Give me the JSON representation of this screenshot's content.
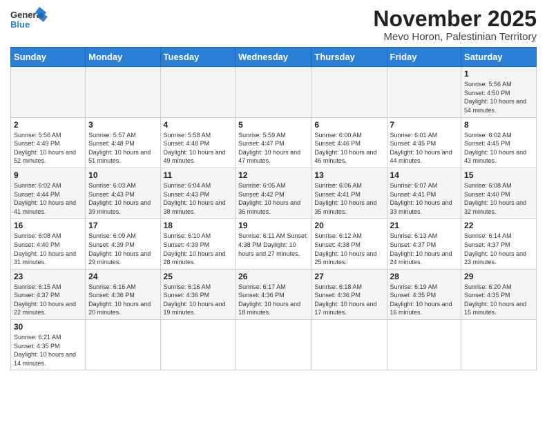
{
  "header": {
    "logo_general": "General",
    "logo_blue": "Blue",
    "month": "November 2025",
    "location": "Mevo Horon, Palestinian Territory"
  },
  "weekdays": [
    "Sunday",
    "Monday",
    "Tuesday",
    "Wednesday",
    "Thursday",
    "Friday",
    "Saturday"
  ],
  "weeks": [
    [
      {
        "day": "",
        "info": ""
      },
      {
        "day": "",
        "info": ""
      },
      {
        "day": "",
        "info": ""
      },
      {
        "day": "",
        "info": ""
      },
      {
        "day": "",
        "info": ""
      },
      {
        "day": "",
        "info": ""
      },
      {
        "day": "1",
        "info": "Sunrise: 5:56 AM\nSunset: 4:50 PM\nDaylight: 10 hours\nand 54 minutes."
      }
    ],
    [
      {
        "day": "2",
        "info": "Sunrise: 5:56 AM\nSunset: 4:49 PM\nDaylight: 10 hours\nand 52 minutes."
      },
      {
        "day": "3",
        "info": "Sunrise: 5:57 AM\nSunset: 4:48 PM\nDaylight: 10 hours\nand 51 minutes."
      },
      {
        "day": "4",
        "info": "Sunrise: 5:58 AM\nSunset: 4:48 PM\nDaylight: 10 hours\nand 49 minutes."
      },
      {
        "day": "5",
        "info": "Sunrise: 5:59 AM\nSunset: 4:47 PM\nDaylight: 10 hours\nand 47 minutes."
      },
      {
        "day": "6",
        "info": "Sunrise: 6:00 AM\nSunset: 4:46 PM\nDaylight: 10 hours\nand 46 minutes."
      },
      {
        "day": "7",
        "info": "Sunrise: 6:01 AM\nSunset: 4:45 PM\nDaylight: 10 hours\nand 44 minutes."
      },
      {
        "day": "8",
        "info": "Sunrise: 6:02 AM\nSunset: 4:45 PM\nDaylight: 10 hours\nand 43 minutes."
      }
    ],
    [
      {
        "day": "9",
        "info": "Sunrise: 6:02 AM\nSunset: 4:44 PM\nDaylight: 10 hours\nand 41 minutes."
      },
      {
        "day": "10",
        "info": "Sunrise: 6:03 AM\nSunset: 4:43 PM\nDaylight: 10 hours\nand 39 minutes."
      },
      {
        "day": "11",
        "info": "Sunrise: 6:04 AM\nSunset: 4:43 PM\nDaylight: 10 hours\nand 38 minutes."
      },
      {
        "day": "12",
        "info": "Sunrise: 6:05 AM\nSunset: 4:42 PM\nDaylight: 10 hours\nand 36 minutes."
      },
      {
        "day": "13",
        "info": "Sunrise: 6:06 AM\nSunset: 4:41 PM\nDaylight: 10 hours\nand 35 minutes."
      },
      {
        "day": "14",
        "info": "Sunrise: 6:07 AM\nSunset: 4:41 PM\nDaylight: 10 hours\nand 33 minutes."
      },
      {
        "day": "15",
        "info": "Sunrise: 6:08 AM\nSunset: 4:40 PM\nDaylight: 10 hours\nand 32 minutes."
      }
    ],
    [
      {
        "day": "16",
        "info": "Sunrise: 6:08 AM\nSunset: 4:40 PM\nDaylight: 10 hours\nand 31 minutes."
      },
      {
        "day": "17",
        "info": "Sunrise: 6:09 AM\nSunset: 4:39 PM\nDaylight: 10 hours\nand 29 minutes."
      },
      {
        "day": "18",
        "info": "Sunrise: 6:10 AM\nSunset: 4:39 PM\nDaylight: 10 hours\nand 28 minutes."
      },
      {
        "day": "19",
        "info": "Sunrise: 6:11 AM\nSunset: 4:38 PM\nDaylight: 10 hours\nand 27 minutes."
      },
      {
        "day": "20",
        "info": "Sunrise: 6:12 AM\nSunset: 4:38 PM\nDaylight: 10 hours\nand 25 minutes."
      },
      {
        "day": "21",
        "info": "Sunrise: 6:13 AM\nSunset: 4:37 PM\nDaylight: 10 hours\nand 24 minutes."
      },
      {
        "day": "22",
        "info": "Sunrise: 6:14 AM\nSunset: 4:37 PM\nDaylight: 10 hours\nand 23 minutes."
      }
    ],
    [
      {
        "day": "23",
        "info": "Sunrise: 6:15 AM\nSunset: 4:37 PM\nDaylight: 10 hours\nand 22 minutes."
      },
      {
        "day": "24",
        "info": "Sunrise: 6:16 AM\nSunset: 4:36 PM\nDaylight: 10 hours\nand 20 minutes."
      },
      {
        "day": "25",
        "info": "Sunrise: 6:16 AM\nSunset: 4:36 PM\nDaylight: 10 hours\nand 19 minutes."
      },
      {
        "day": "26",
        "info": "Sunrise: 6:17 AM\nSunset: 4:36 PM\nDaylight: 10 hours\nand 18 minutes."
      },
      {
        "day": "27",
        "info": "Sunrise: 6:18 AM\nSunset: 4:36 PM\nDaylight: 10 hours\nand 17 minutes."
      },
      {
        "day": "28",
        "info": "Sunrise: 6:19 AM\nSunset: 4:35 PM\nDaylight: 10 hours\nand 16 minutes."
      },
      {
        "day": "29",
        "info": "Sunrise: 6:20 AM\nSunset: 4:35 PM\nDaylight: 10 hours\nand 15 minutes."
      }
    ],
    [
      {
        "day": "30",
        "info": "Sunrise: 6:21 AM\nSunset: 4:35 PM\nDaylight: 10 hours\nand 14 minutes."
      },
      {
        "day": "",
        "info": ""
      },
      {
        "day": "",
        "info": ""
      },
      {
        "day": "",
        "info": ""
      },
      {
        "day": "",
        "info": ""
      },
      {
        "day": "",
        "info": ""
      },
      {
        "day": "",
        "info": ""
      }
    ]
  ]
}
